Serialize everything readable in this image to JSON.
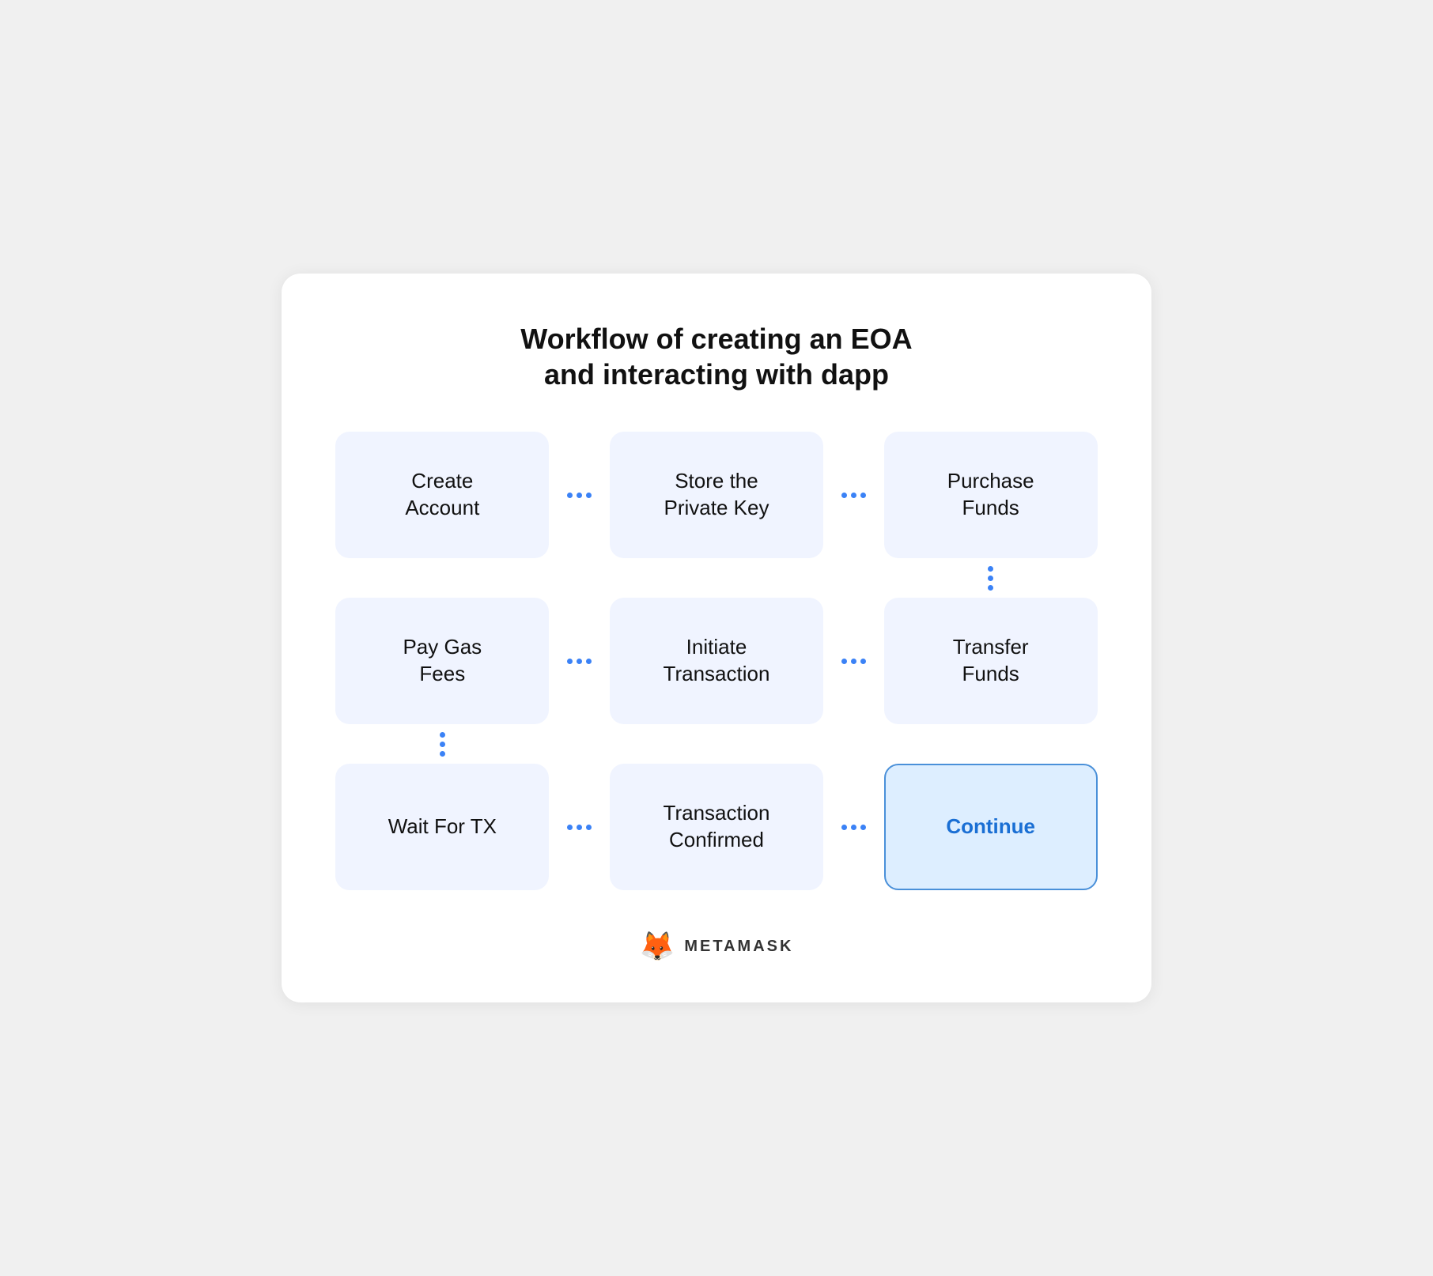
{
  "page": {
    "title_line1": "Workflow of creating an EOA",
    "title_line2": "and interacting with dapp"
  },
  "steps": {
    "row1": [
      {
        "id": "create-account",
        "label": "Create\nAccount",
        "highlighted": false
      },
      {
        "id": "store-private-key",
        "label": "Store the\nPrivate Key",
        "highlighted": false
      },
      {
        "id": "purchase-funds",
        "label": "Purchase\nFunds",
        "highlighted": false
      }
    ],
    "row2": [
      {
        "id": "pay-gas-fees",
        "label": "Pay Gas\nFees",
        "highlighted": false
      },
      {
        "id": "initiate-transaction",
        "label": "Initiate\nTransaction",
        "highlighted": false
      },
      {
        "id": "transfer-funds",
        "label": "Transfer\nFunds",
        "highlighted": false
      }
    ],
    "row3": [
      {
        "id": "wait-for-tx",
        "label": "Wait For TX",
        "highlighted": false
      },
      {
        "id": "transaction-confirmed",
        "label": "Transaction\nConfirmed",
        "highlighted": false
      },
      {
        "id": "continue",
        "label": "Continue",
        "highlighted": true,
        "blue": true
      }
    ]
  },
  "footer": {
    "icon": "🦊",
    "brand": "METAMASK"
  },
  "arrows": {
    "h_label": "→",
    "v_label": "↓"
  }
}
